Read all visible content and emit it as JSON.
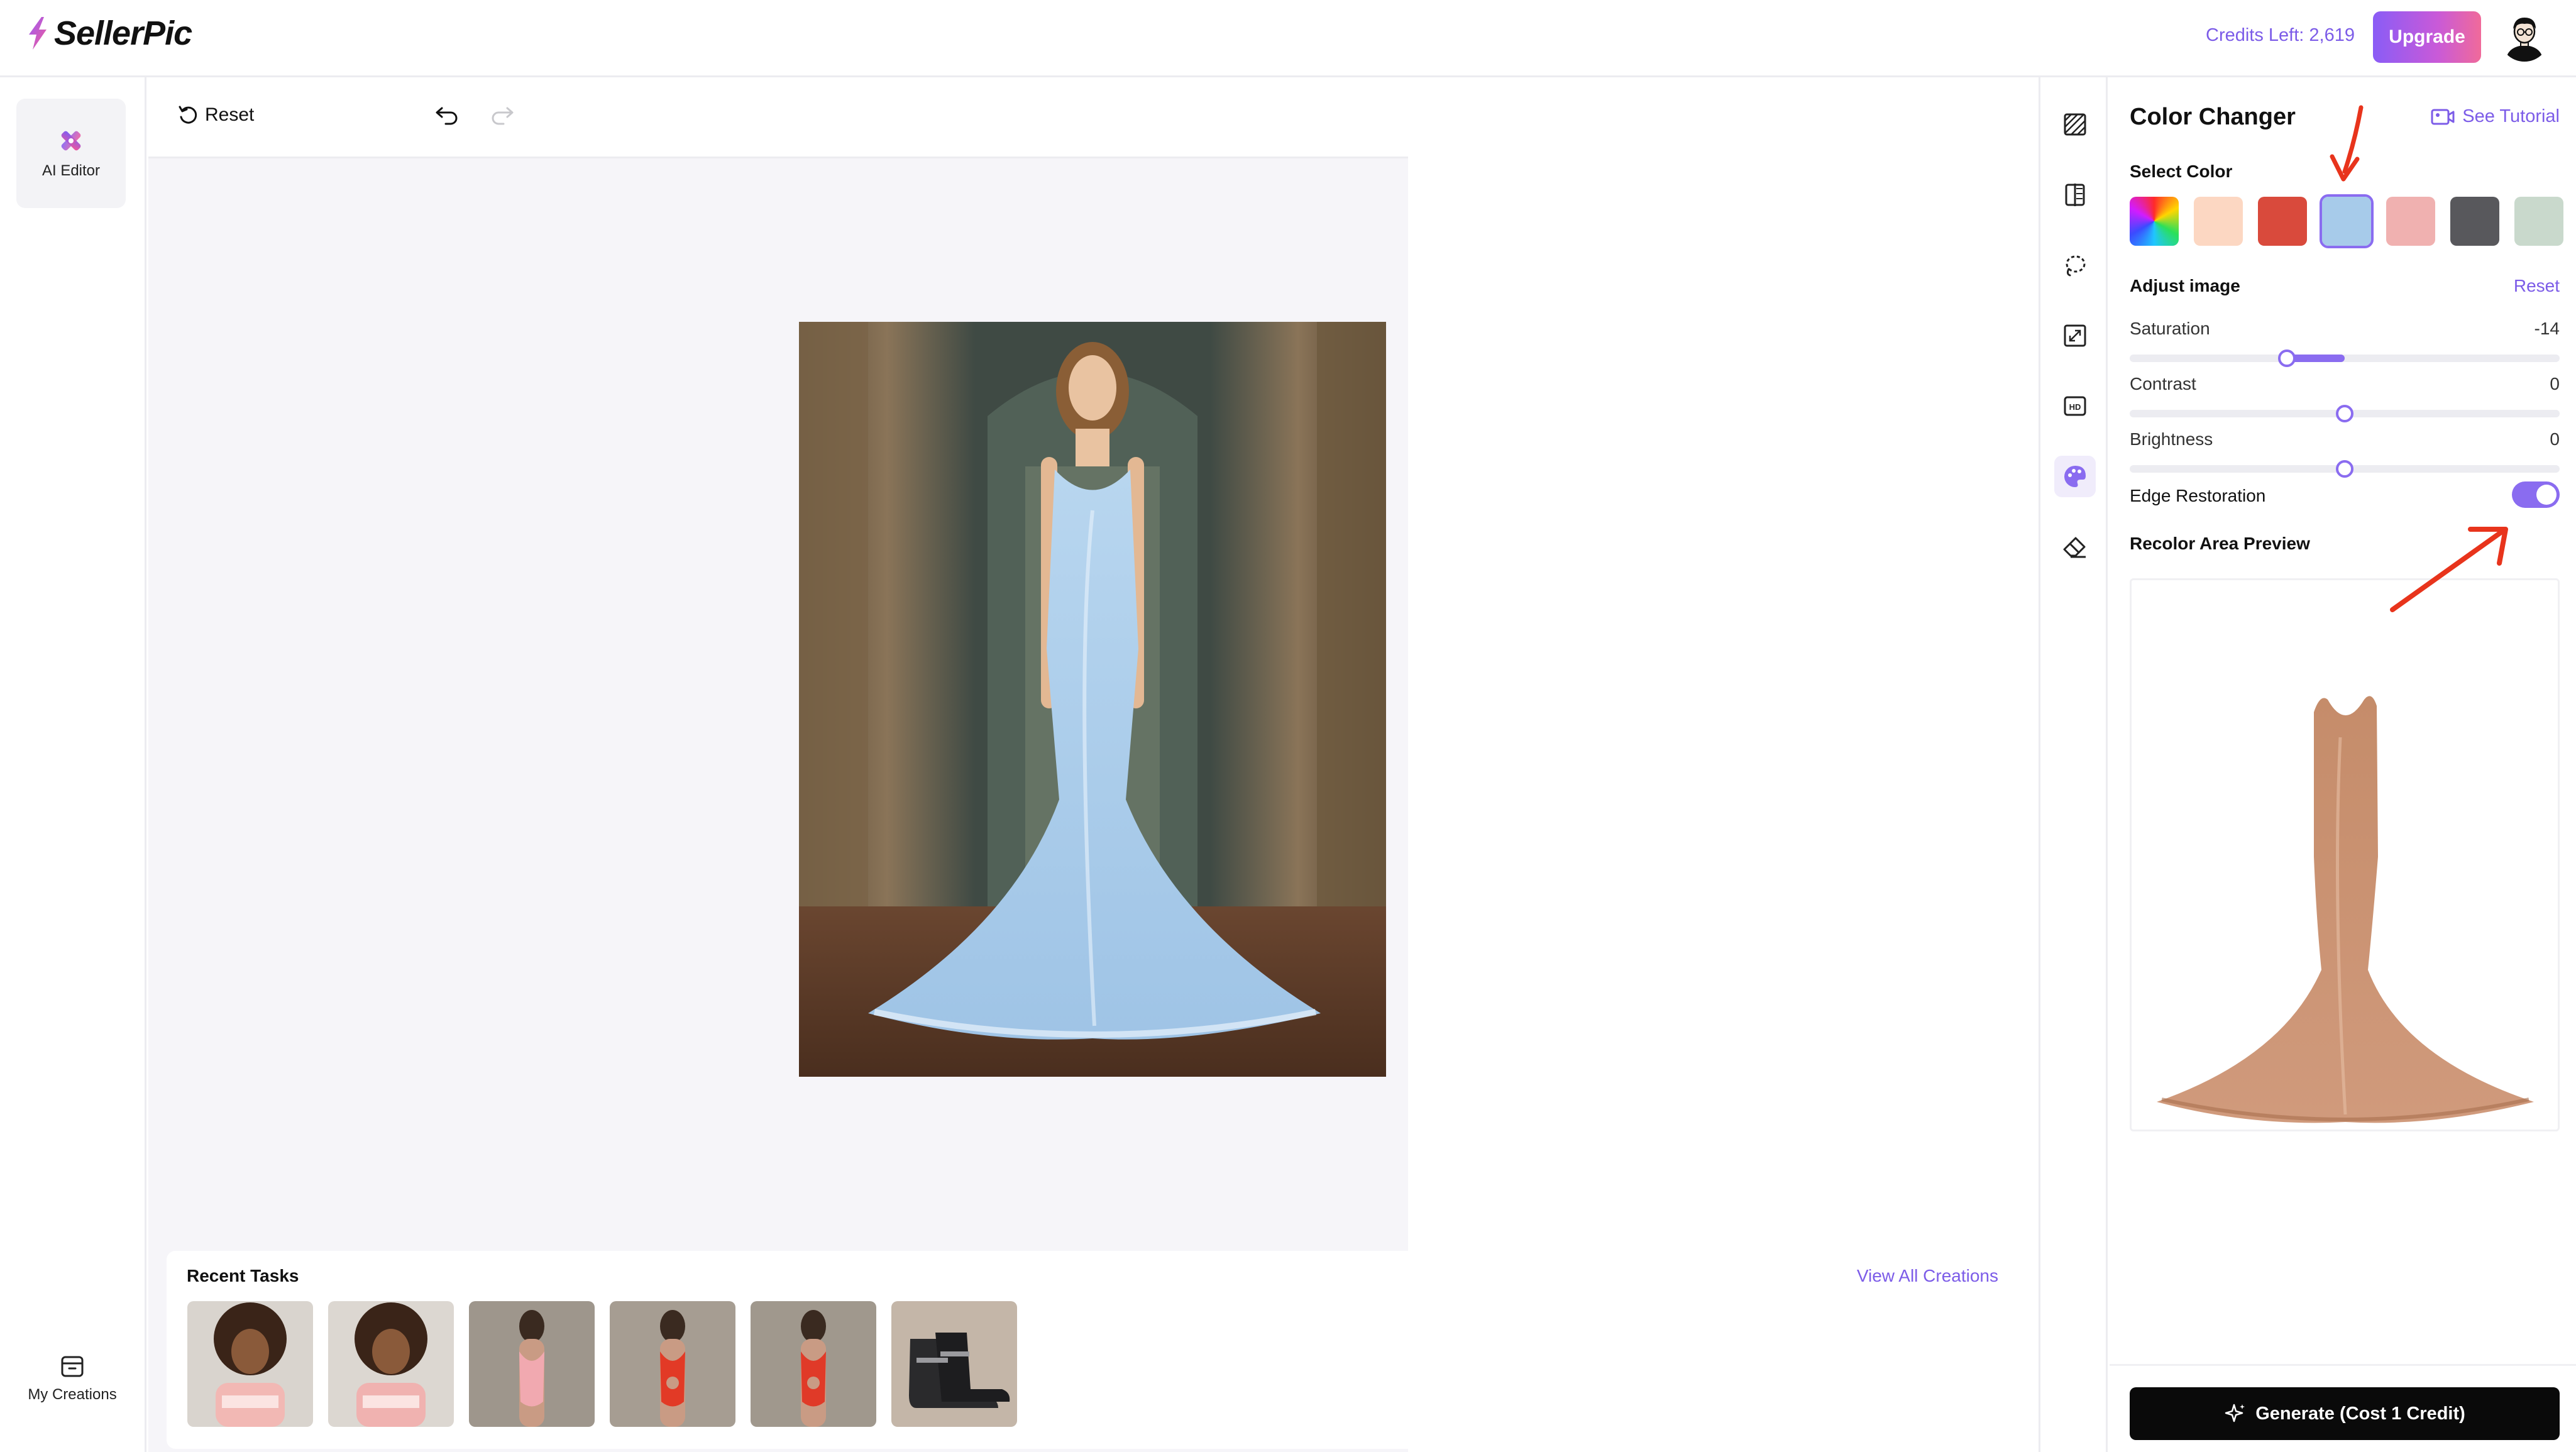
{
  "header": {
    "app_name": "SellerPic",
    "credits_text": "Credits Left: 2,619",
    "upgrade_label": "Upgrade"
  },
  "leftnav": {
    "ai_editor_label": "AI Editor",
    "my_creations_label": "My Creations"
  },
  "toolbar": {
    "reset_label": "Reset"
  },
  "recent": {
    "title": "Recent Tasks",
    "view_all_label": "View All Creations",
    "thumbnails": [
      "curly-hair-woman-pink-top",
      "curly-hair-woman-pink-top",
      "woman-pink-swimsuit",
      "woman-red-swimsuit",
      "woman-red-swimsuit",
      "black-buckle-boots"
    ]
  },
  "tools": [
    "stripes-pattern-icon",
    "compare-icon",
    "lasso-icon",
    "expand-icon",
    "hd-icon",
    "palette-icon",
    "eraser-icon"
  ],
  "panel": {
    "title": "Color Changer",
    "tutorial_label": "See Tutorial",
    "select_color_label": "Select Color",
    "swatches": [
      {
        "name": "rainbow",
        "color": "conic"
      },
      {
        "name": "peach",
        "color": "#fcd7c2"
      },
      {
        "name": "red",
        "color": "#d94a3c"
      },
      {
        "name": "light-blue",
        "color": "#a7cbea",
        "selected": true
      },
      {
        "name": "pink",
        "color": "#f0b1b0"
      },
      {
        "name": "dark-gray",
        "color": "#58585c"
      },
      {
        "name": "sage",
        "color": "#c9d9cc"
      }
    ],
    "adjust_label": "Adjust image",
    "reset_label": "Reset",
    "saturation": {
      "label": "Saturation",
      "value": "-14"
    },
    "contrast": {
      "label": "Contrast",
      "value": "0"
    },
    "brightness": {
      "label": "Brightness",
      "value": "0"
    },
    "edge_restoration_label": "Edge Restoration",
    "edge_restoration_on": true,
    "preview_label": "Recolor Area Preview",
    "generate_label": "Generate (Cost 1 Credit)"
  },
  "colors": {
    "accent": "#8a6cf0",
    "annotation_arrow": "#e8341c"
  }
}
